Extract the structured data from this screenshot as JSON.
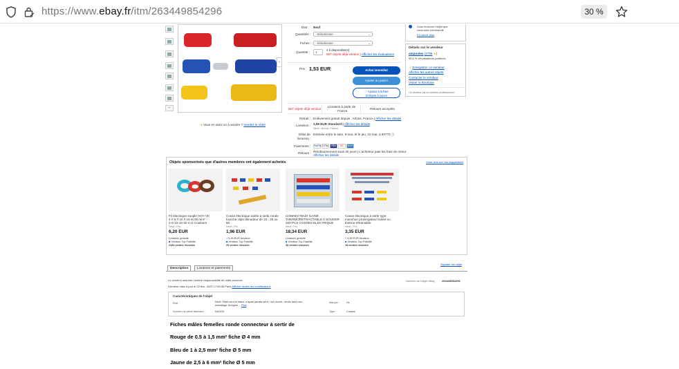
{
  "browser": {
    "url_prefix": "https://www.",
    "url_domain": "ebay.fr",
    "url_path": "/itm/263449854296",
    "zoom": "30 %"
  },
  "listing": {
    "condition_label": "État :",
    "condition_value": "Neuf",
    "quantity_option_label": "Quantités :",
    "quantity_option_placeholder": "- Sélectionner -",
    "plug_label": "Fiches :",
    "plug_placeholder": "- Sélectionner -",
    "quantity_label": "Quantité :",
    "quantity_value": "1",
    "available": "4 k disponible(s)",
    "sold": "567 objets déjà vendus",
    "view_reviews": "Afficher les évaluations",
    "price_label": "Prix :",
    "price": "1,53 EUR",
    "buy_now": "Achat immédiat",
    "add_to_cart": "Ajouter au panier",
    "watch_line1": "♡ Ajouter à la liste",
    "watch_line2": "d'Objets à suivre",
    "highlights": [
      "567 objets déjà vendus",
      "Livraison à partir de : France",
      "Retours acceptés"
    ],
    "pickup_label": "Retrait :",
    "pickup_value": "Enlèvement gratuit depuis : Arbois, France |",
    "pickup_link": "Afficher les détails",
    "shipping_label": "Livraison :",
    "shipping_value": "3,99 EUR Standard |",
    "shipping_link": "Afficher les détails",
    "shipping_note": "Situé : Arbois, France",
    "delivery_label_1": "Délai de",
    "delivery_label_2": "livraison :",
    "delivery_value": "Estimée entre le sam. 9 mar. et le jeu. 16 mar. à 59770",
    "payments_label": "Paiements :",
    "payment_methods": [
      "PayPal",
      "G Pay",
      "VISA",
      "MC",
      "Amex"
    ],
    "returns_label": "Retours :",
    "returns_value": "Remboursement sous 30 jours | L'acheteur paie les frais de retour",
    "returns_link": "Afficher les détails",
    "share_text": "Vous en avez un à vendre ?",
    "share_link": "Vendez le vôtre"
  },
  "seller": {
    "guarantee_line": "Vous recevrez l'objet que",
    "guarantee_line2": "vous avez commandé.",
    "guarantee_link": "En savoir plus",
    "title": "Détails sur le vendeur",
    "name": "ampoulex",
    "score": "(2786",
    "feedback": "99,6 % d'évaluations positives",
    "save_seller": "Enregistrer ce vendeur",
    "other_items": "Afficher les autres objets",
    "contact": "Contacter le vendeur",
    "shop": "Visiter la Boutique",
    "pro": "Ce vendeur est un vendeur professionnel."
  },
  "sponsored": {
    "title": "Objets sponsorisés que d'autres membres ont également achetés",
    "feedback_link": "Votre avis sur nos suggestions",
    "cards": [
      {
        "title1": "Fil électrique souple HO7-VK",
        "title2": "4 rl 6 rl 10 rl 16 et 35 mm² -",
        "title3": "2-5-10-15-20 m 5 Couleurs",
        "cond": "Neuf - Pro",
        "price": "6,20 EUR",
        "ship": "Livraison gratuite",
        "badge": "Vendeur Top Fiabilité",
        "sold": "2184 ventes réussies"
      },
      {
        "title1": "Cosse électrique isolée à sertir ronde",
        "title2": "fourche clips dénudeur de 10 , 25 ou",
        "title3": "50",
        "cond": "Neuf - Pro",
        "price": "1,96 EUR",
        "ship": "+ 5,49 EUR livraison",
        "badge": "Vendeur Top Fiabilité",
        "sold": "29 ventes réussies"
      },
      {
        "title1": "CONNECTEUR GAINE",
        "title2": "THERMORETRACTABLE A SOUDER",
        "title3": "200 PCS COSSES ELECTRIQUE",
        "cond": "Neuf - Pro",
        "price": "18,34 EUR",
        "ship": "Livraison gratuite",
        "badge": "Vendeur Top Fiabilité",
        "sold": "46 ventes réussies"
      },
      {
        "title1": "Cosse électrique à sertir type",
        "title2": "manchon prolongateur isolée ou",
        "title3": "thermo-rétractable",
        "cond": "Neuf - Pro",
        "price": "3,35 EUR",
        "ship": "+ 4,99 EUR livraison",
        "badge": "Vendeur Top Fiabilité",
        "sold": "18 ventes réussies"
      }
    ]
  },
  "description": {
    "tabs": [
      "Description",
      "Livraison et paiements"
    ],
    "report": "Signaler cet objet",
    "responsibility": "Le vendeur assume l'entière responsabilité de cette annonce.",
    "item_number_label": "Numéro de l'objet eBay :",
    "item_number": "263449854296",
    "last_update": "Dernière mise à jour le 22 févr. 2023 17:09:36 Paris",
    "view_changes": "Afficher toutes les modifications",
    "specs_title": "Caractéristiques de l'objet",
    "state_label": "État :",
    "state_value": "Neuf: Objet neuf et intact, n'ayant jamais servi, non ouvert, vendu dans son",
    "state_value2": "emballage d'origine ...",
    "state_more": "Plus",
    "part_label": "Numéro de pièce fabricant :",
    "part_value": "NoGO0",
    "brand_label": "Marque :",
    "brand_value": "HL",
    "type_label": "Type :",
    "type_value": "Cosses",
    "lines": [
      "Fiches mâles femelles ronde connecteur à sertir de",
      "Rouge de 0.5 à 1,5 mm² fiche Ø  4 mm",
      "Bleu de 1 à 2,5 mm²  fiche Ø  5 mm",
      "Jaune de 2,5 à 6 mm² fiche Ø  5 mm"
    ]
  },
  "colors": {
    "ebay_blue": "#0654ba",
    "red": "#dd1e31",
    "connector_red": "#d8262b",
    "connector_blue": "#2553b5",
    "connector_yellow": "#f3c51a"
  }
}
